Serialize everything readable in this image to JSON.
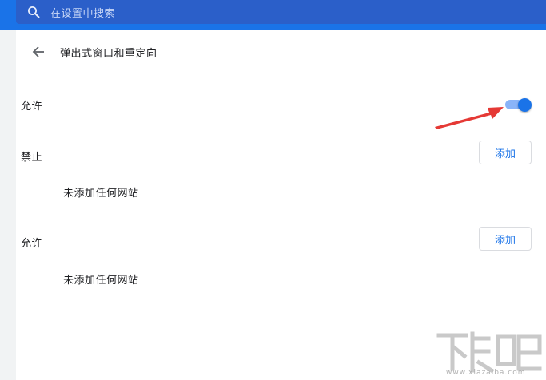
{
  "search": {
    "placeholder": "在设置中搜索",
    "icon": "search-icon"
  },
  "header": {
    "back_icon": "arrow-back-icon",
    "title": "弹出式窗口和重定向"
  },
  "master_toggle": {
    "label": "允许",
    "state": "on"
  },
  "sections": [
    {
      "label": "禁止",
      "add_button": "添加",
      "empty_text": "未添加任何网站"
    },
    {
      "label": "允许",
      "add_button": "添加",
      "empty_text": "未添加任何网站"
    }
  ],
  "colors": {
    "accent": "#1a73e8",
    "topbar": "#1a73e8",
    "search_box": "#2b5fc9",
    "annotation_arrow": "#e53935"
  },
  "watermark": {
    "logo_text": "下载吧",
    "domain": "www.xiazaiba.com"
  }
}
